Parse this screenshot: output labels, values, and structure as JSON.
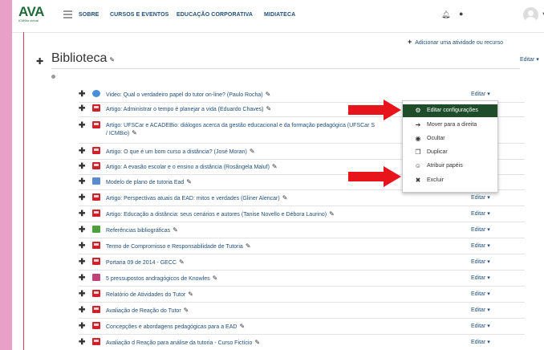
{
  "logo": {
    "main": "AVA",
    "sub": "ICMBio virtual"
  },
  "nav": {
    "items": [
      "SOBRE",
      "CURSOS E EVENTOS",
      "EDUCAÇÃO CORPORATIVA",
      "MIDIATECA"
    ]
  },
  "header_icons": {
    "bell": "bell-icon",
    "chat": "chat-icon",
    "user": "user-avatar-icon"
  },
  "add_activity": "Adicionar uma atividade ou recurso",
  "section": {
    "title": "Biblioteca",
    "edit_label": "Editar"
  },
  "row_edit_label": "Editar",
  "activities": [
    {
      "title": "Video: Qual o verdadeiro papel do tutor on-line? (Paulo Rocha)",
      "icon": "video-icon"
    },
    {
      "title": "Artigo: Administrar o tempo é planejar a vida (Eduardo Chaves)",
      "icon": "pdf-icon"
    },
    {
      "title": "Artigo: UFSCar e ACADEBio: diálogos acerca da gestão educacional e da formação pedagógica (UFSCar S",
      "title_line2": "/ ICMBio)",
      "icon": "pdf-icon"
    },
    {
      "title": "Artigo: O que é um bom curso a distância? (José Moran)",
      "icon": "pdf-icon"
    },
    {
      "title": "Artigo: A evasão escolar e o ensino a distância (Rosângela Maluf)",
      "icon": "pdf-icon"
    },
    {
      "title": "Modelo de plano de tutoria Ead",
      "icon": "document-icon"
    },
    {
      "title": "Artigo: Perspectivas atuais da EAD: mitos e verdades (Gliner Alencar)",
      "icon": "pdf-icon"
    },
    {
      "title": "Artigo: Educação a distância: seus cenários e autores (Tanise Novello e Débora Laurino)",
      "icon": "pdf-icon"
    },
    {
      "title": "Referências bibliográficas",
      "icon": "book-icon"
    },
    {
      "title": "Termo de Compromisso e Responsabilidade de Tutoria",
      "icon": "pdf-icon"
    },
    {
      "title": "Portaria 09 de 2014 - GECC",
      "icon": "pdf-icon"
    },
    {
      "title": "5 pressupostos andragógicos de Knowles",
      "icon": "presentation-icon"
    },
    {
      "title": "Relatório de Atividades do Tutor",
      "icon": "pdf-icon"
    },
    {
      "title": "Avaliação de Reação do Tutor",
      "icon": "pdf-icon"
    },
    {
      "title": "Concepções e abordagens pedagógicas para a EAD",
      "icon": "pdf-icon"
    },
    {
      "title": "Avaliação d Reação para análise da tutoria - Curso Fictício",
      "icon": "pdf-icon"
    }
  ],
  "context_menu": {
    "items": [
      {
        "label": "Editar configurações",
        "icon": "gear-icon",
        "active": true
      },
      {
        "label": "Mover para a direita",
        "icon": "arrow-right-icon"
      },
      {
        "label": "Ocultar",
        "icon": "eye-icon"
      },
      {
        "label": "Duplicar",
        "icon": "copy-icon"
      },
      {
        "label": "Atribuir papéis",
        "icon": "user-icon"
      },
      {
        "label": "Excluir",
        "icon": "trash-icon"
      }
    ]
  },
  "colors": {
    "accent": "#1f4d2a",
    "link": "#1f4e79",
    "arrow": "#e8141b",
    "border_accent": "#d13a5c",
    "background": "#e8a0c9"
  }
}
